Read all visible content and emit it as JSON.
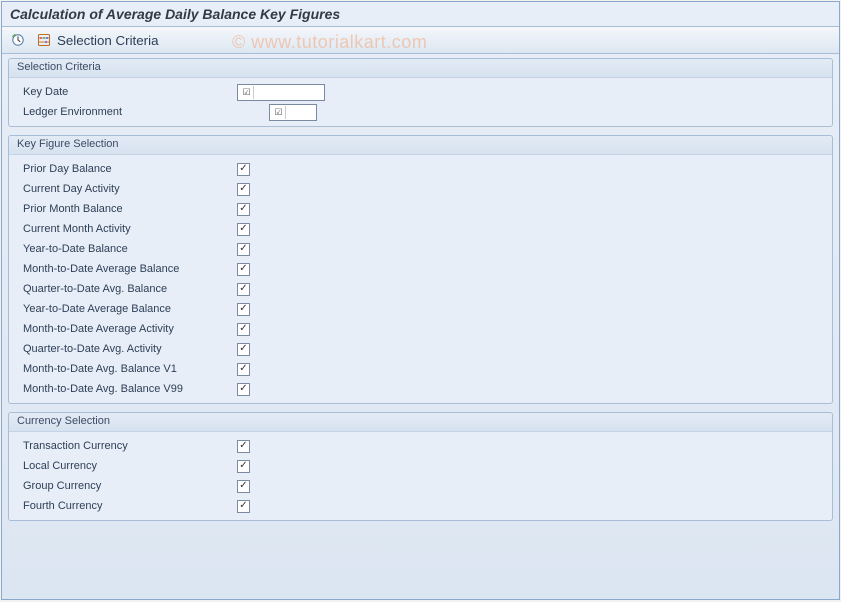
{
  "title": "Calculation of Average Daily Balance Key Figures",
  "watermark": "© www.tutorialkart.com",
  "toolbar": {
    "selection_criteria": "Selection Criteria"
  },
  "groups": {
    "selection_criteria": {
      "title": "Selection Criteria",
      "fields": [
        {
          "label": "Key Date",
          "value": ""
        },
        {
          "label": "Ledger Environment",
          "value": ""
        }
      ]
    },
    "key_figure": {
      "title": "Key Figure Selection",
      "items": [
        {
          "label": "Prior Day Balance",
          "checked": true
        },
        {
          "label": "Current Day Activity",
          "checked": true
        },
        {
          "label": "Prior Month Balance",
          "checked": true
        },
        {
          "label": "Current Month Activity",
          "checked": true
        },
        {
          "label": "Year-to-Date Balance",
          "checked": true
        },
        {
          "label": "Month-to-Date Average Balance",
          "checked": true
        },
        {
          "label": "Quarter-to-Date Avg. Balance",
          "checked": true
        },
        {
          "label": "Year-to-Date Average Balance",
          "checked": true
        },
        {
          "label": "Month-to-Date Average Activity",
          "checked": true
        },
        {
          "label": "Quarter-to-Date Avg. Activity",
          "checked": true
        },
        {
          "label": "Month-to-Date Avg. Balance V1",
          "checked": true
        },
        {
          "label": "Month-to-Date Avg. Balance V99",
          "checked": true
        }
      ]
    },
    "currency": {
      "title": "Currency Selection",
      "items": [
        {
          "label": "Transaction Currency",
          "checked": true
        },
        {
          "label": "Local Currency",
          "checked": true
        },
        {
          "label": "Group Currency",
          "checked": true
        },
        {
          "label": "Fourth Currency",
          "checked": true
        }
      ]
    }
  }
}
